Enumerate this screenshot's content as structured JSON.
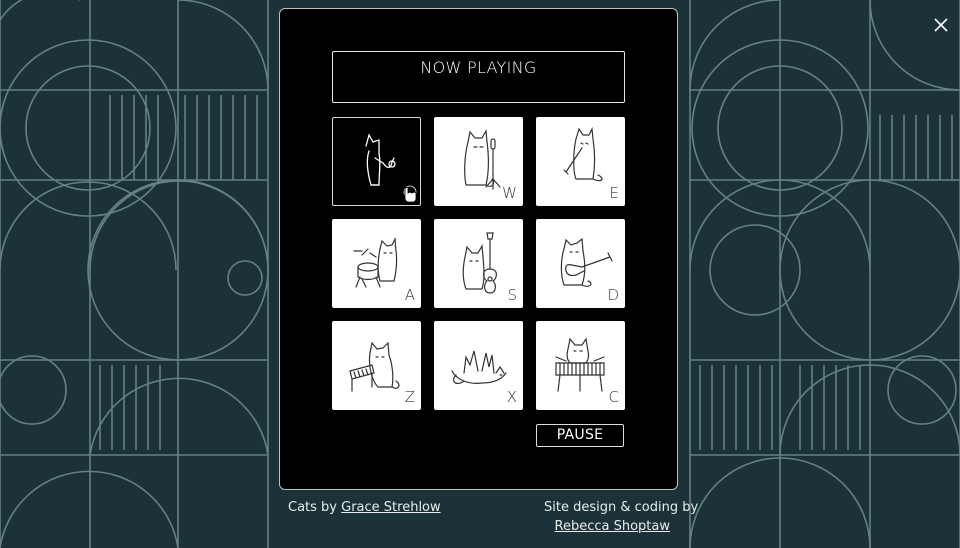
{
  "now_playing": {
    "label": "NOW PLAYING",
    "track": ""
  },
  "tiles": [
    {
      "key": "",
      "cat": "saxophone",
      "active": true
    },
    {
      "key": "W",
      "cat": "microphone"
    },
    {
      "key": "E",
      "cat": "clarinet"
    },
    {
      "key": "A",
      "cat": "drums"
    },
    {
      "key": "S",
      "cat": "acoustic-guitar"
    },
    {
      "key": "D",
      "cat": "electric-guitar"
    },
    {
      "key": "Z",
      "cat": "keyboard"
    },
    {
      "key": "X",
      "cat": "sleeping"
    },
    {
      "key": "C",
      "cat": "xylophone"
    }
  ],
  "pause_label": "PAUSE",
  "footer": {
    "cats_by": "Cats by",
    "cats_artist": "Grace Strehlow",
    "site_by": "Site design & coding by",
    "site_author": "Rebecca Shoptaw"
  },
  "colors": {
    "background": "#1b3338",
    "pattern_line": "#8fa9ab",
    "panel": "#000000"
  },
  "icons": {
    "close": "close-icon",
    "cursor": "hand-pointer-icon"
  }
}
